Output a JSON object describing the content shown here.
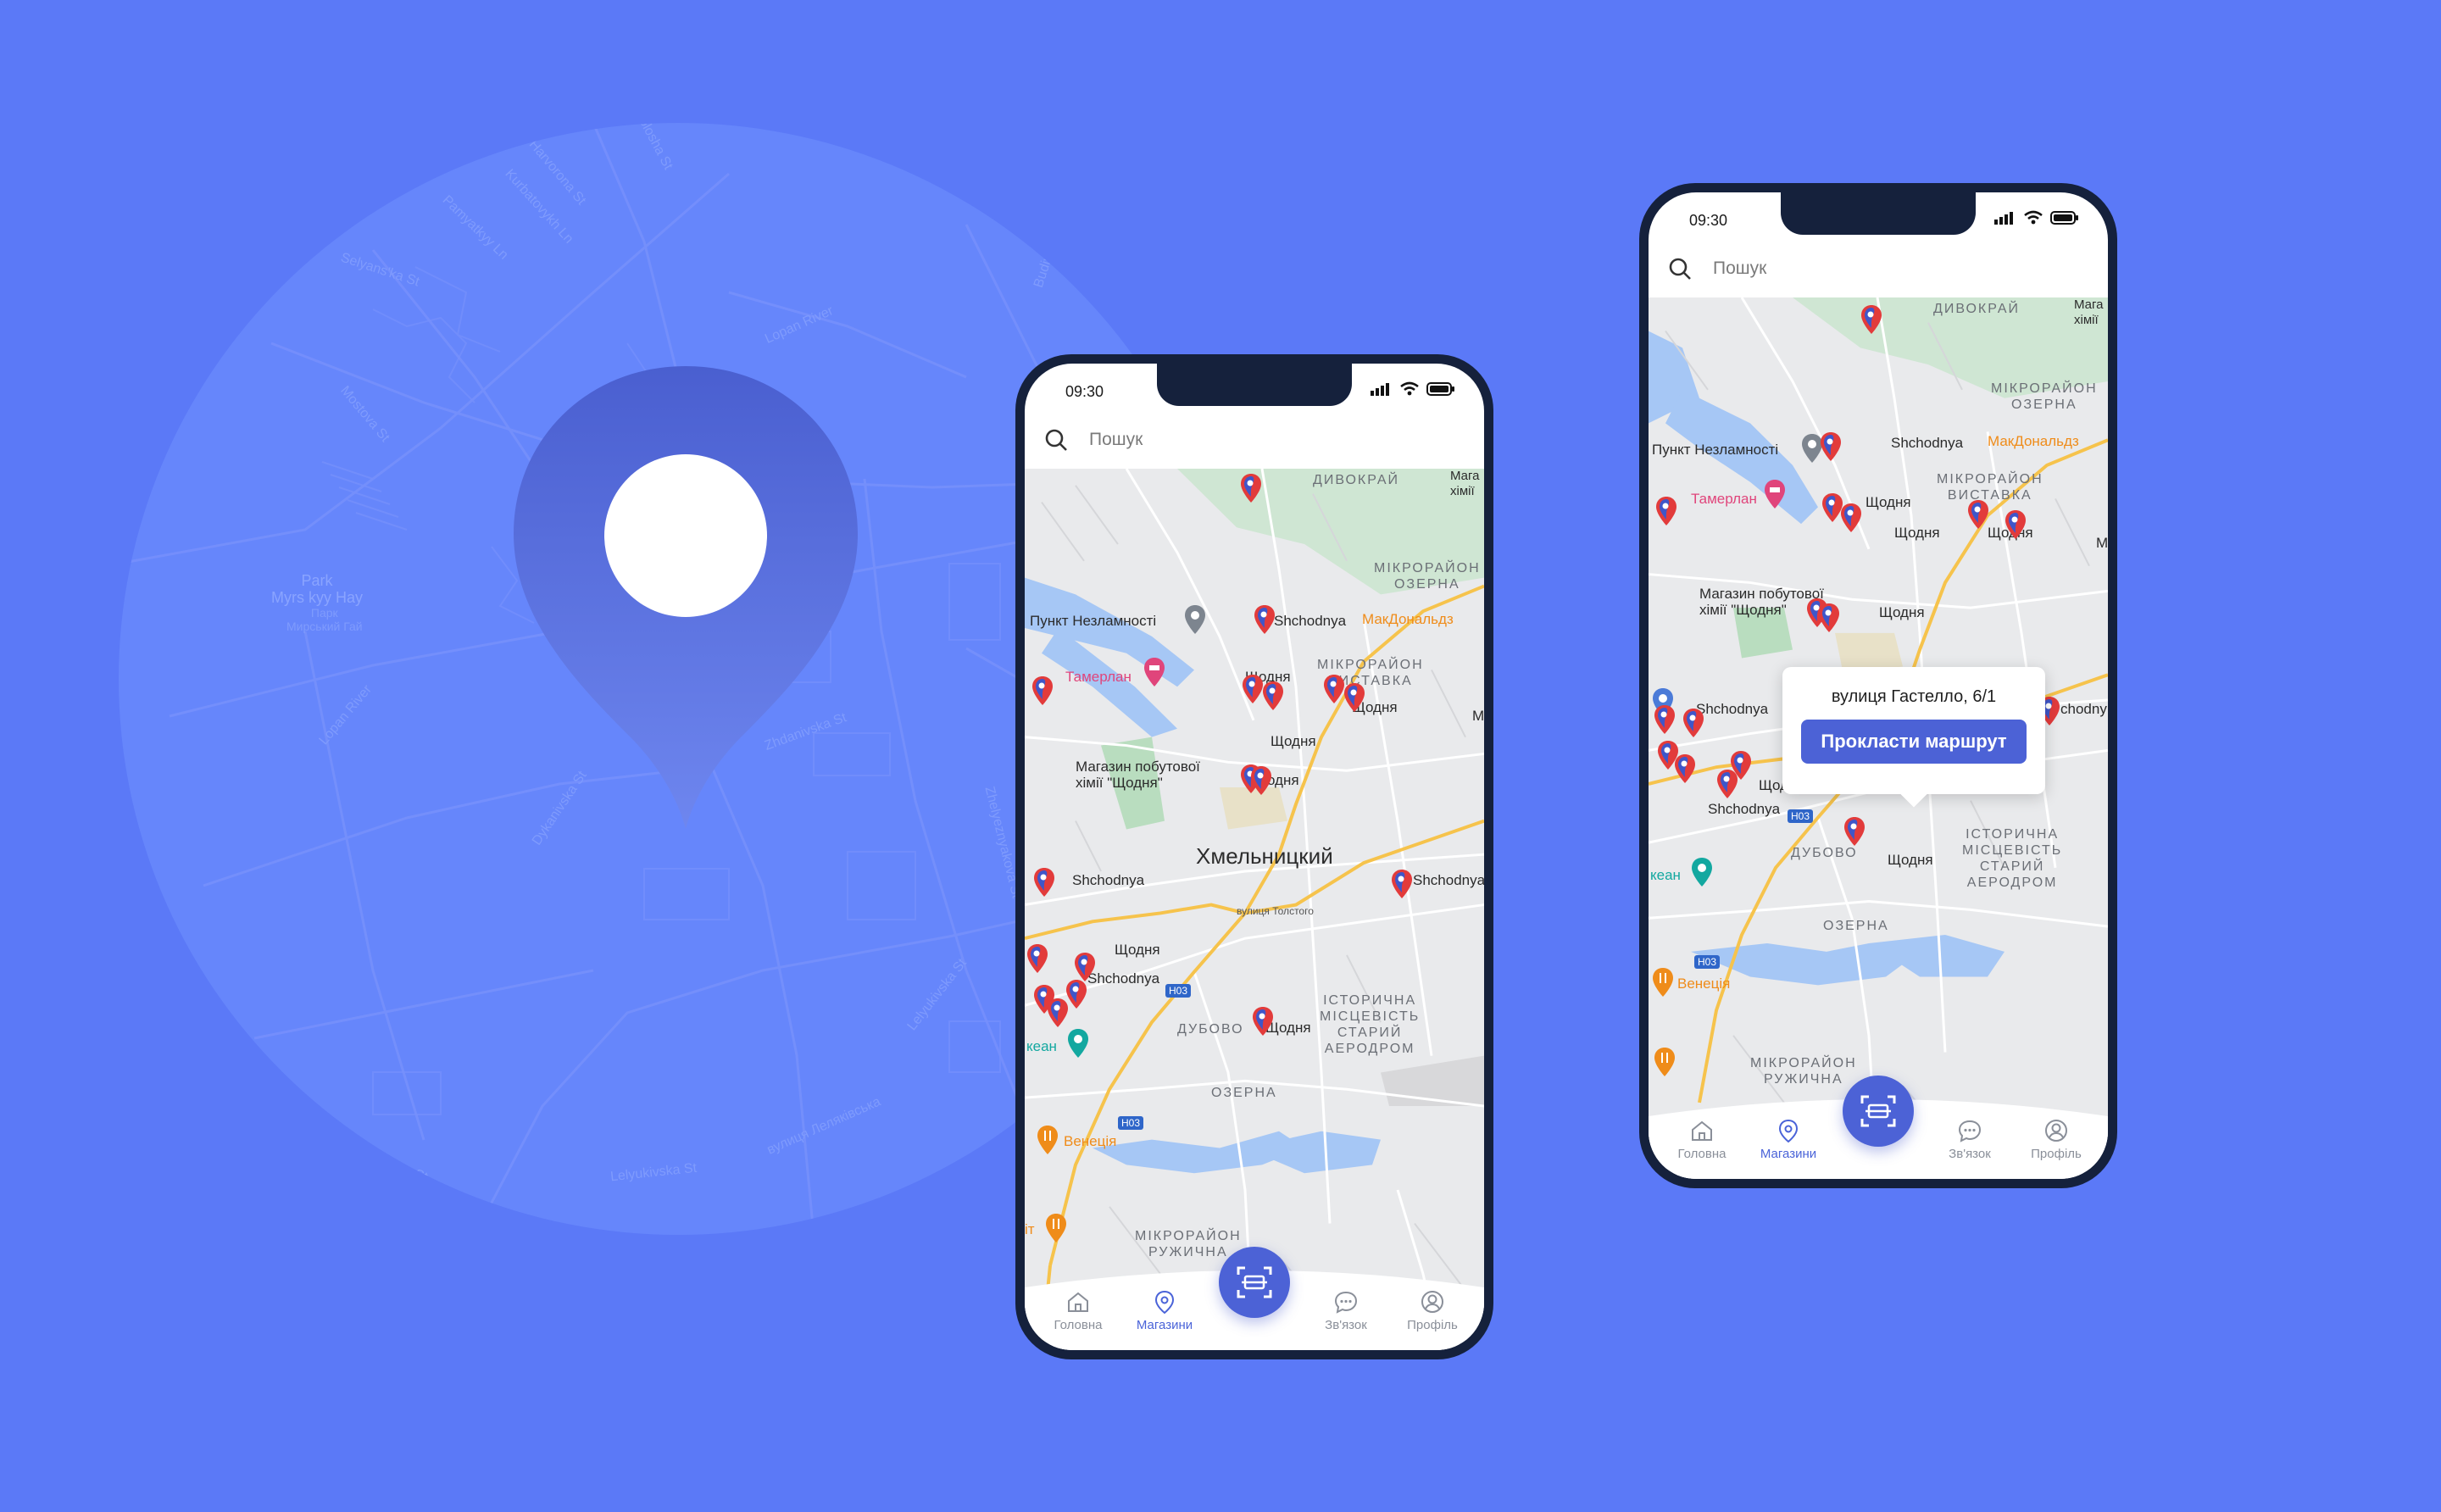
{
  "background": {
    "street_labels": [
      "Molosha St",
      "Harvorona St",
      "Kurbatovykh Ln",
      "Selyans'ka St",
      "Pamyatkyy Ln",
      "Lopan River",
      "Myrskyy Hay",
      "Mostova St",
      "Lopan River",
      "Dykanivska St",
      "Zhdanivska St",
      "Dykanivska St",
      "Zhelyeznyakova St",
      "Lelyukivska St",
      "вулиця Леляківська",
      "Lelyukivska St",
      "Budivnych",
      "Selyans'ka St"
    ],
    "park_label": "Park\nMyrs kyy Hay",
    "park_sub": "Парк\nМирський Гай"
  },
  "phone_left": {
    "status_time": "09:30",
    "search_placeholder": "Пошук",
    "city": "Хмельницкий",
    "areas": [
      "ДИВОКРАЙ",
      "МІКРОРАЙОН\nОЗЕРНА",
      "МІКРОРАЙОН\nВИСТАВКА",
      "ДУБОВО",
      "ІСТОРИЧНА\nМІСЦЕВІСТЬ\nСТАРИЙ\nАЕРОДРОМ",
      "ОЗЕРНА",
      "МІКРОРАЙОН\nРУЖИЧНА"
    ],
    "pois": {
      "punkt": "Пункт Незламності",
      "tamerlan": "Тамерлан",
      "mcd": "МакДональдз",
      "magazin": "Магазин побутової\nхімії \"Щодня\"",
      "okean": "кеан",
      "venetsia": "Венеція",
      "it": "іт",
      "maga": "Мага\nхімії"
    },
    "store_labels": [
      "Shchodnya",
      "Щодня",
      "Щодня",
      "Щодня",
      "Щодня",
      "Shchodnya",
      "Щодня",
      "Shchodnya",
      "Щодня",
      "Shchodnya",
      "М"
    ],
    "road_badges": [
      "H03",
      "H03"
    ],
    "street": "вулиця Толстого",
    "nav": [
      "Головна",
      "Магазини",
      "Зв'язок",
      "Профіль"
    ]
  },
  "phone_right": {
    "status_time": "09:30",
    "search_placeholder": "Пошук",
    "areas": [
      "ДИВОКРАЙ",
      "МІКРОРАЙОН\nОЗЕРНА",
      "МІКРОРАЙОН\nВИСТАВКА",
      "ДУБОВО",
      "ІСТОРИЧНА\nМІСЦЕВІСТЬ\nСТАРИЙ\nАЕРОДРОМ",
      "ОЗЕРНА",
      "МІКРОРАЙОН\nРУЖИЧНА"
    ],
    "pois": {
      "punkt": "Пункт Незламності",
      "tamerlan": "Тамерлан",
      "mcd": "МакДональдз",
      "magazin": "Магазин побутової\nхімії \"Щодня\"",
      "okean": "кеан",
      "venetsia": "Венеція",
      "maga": "Мага\nхімії"
    },
    "store_labels": [
      "Shchodnya",
      "Щодня",
      "Щодня",
      "Щодня",
      "Щодня",
      "Shchodnya",
      "Щодня",
      "Shchodnya",
      "Щодня",
      "chodny",
      "М"
    ],
    "road_badges": [
      "H03",
      "H03"
    ],
    "popup": {
      "address": "вулиця Гастелло, 6/1",
      "button": "Прокласти маршрут"
    },
    "nav": [
      "Головна",
      "Магазини",
      "Зв'язок",
      "Профіль"
    ]
  },
  "colors": {
    "background": "#5b79f7",
    "accent": "#4c62d6",
    "pin_red": "#e23b3b",
    "pin_blue": "#3f56c9",
    "phone_frame": "#15213c"
  },
  "icons": [
    "search-icon",
    "home-icon",
    "map-pin-icon",
    "scan-icon",
    "chat-icon",
    "profile-icon",
    "signal-icon",
    "wifi-icon",
    "battery-icon"
  ]
}
